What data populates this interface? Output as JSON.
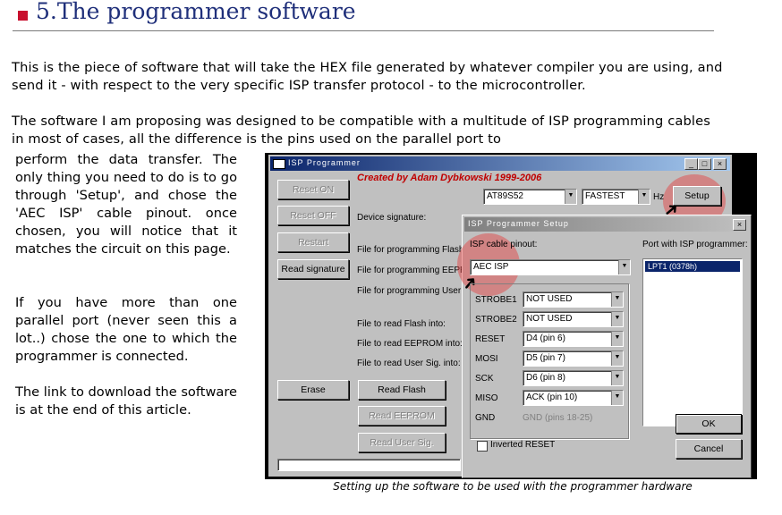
{
  "heading": "5.The programmer software",
  "paragraphs": [
    "This is the piece of software that will take the HEX file generated by whatever compiler you are using, and",
    "send it - with respect to the very specific ISP transfer protocol - to the microcontroller.",
    "The software I am proposing was designed to be compatible with a multitude of ISP programming cables",
    "in most of cases, all the difference is the pins used on the parallel port to"
  ],
  "side_text": {
    "p1": "perform the data transfer. The only thing you need to do is to go through 'Setup', and chose the 'AEC ISP' cable pinout. once chosen, you will notice that it matches the circuit on this page.",
    "p2": "If you have more than one parallel port (never seen this a lot..) chose the one to which the programmer is connected.",
    "p3": "The link to download the software is at the end of this article."
  },
  "caption": "Setting up the software to be used with the programmer hardware",
  "main_window": {
    "title": "ISP Programmer",
    "credit": "Created by Adam Dybkowski  1999-2006",
    "device": "AT89S52",
    "speed": "FASTEST",
    "hz": "Hz",
    "setup_button": "Setup",
    "buttons": {
      "reset_on": "Reset ON",
      "reset_off": "Reset OFF",
      "restart": "Restart",
      "read_signature": "Read signature",
      "erase": "Erase",
      "read_flash": "Read Flash",
      "read_eeprom": "Read EEPROM",
      "read_user_sig": "Read User Sig."
    },
    "labels": {
      "device_signature": "Device signature:",
      "file_prog_flash": "File for programming Flash",
      "file_prog_eeprom": "File for programming EEPR",
      "file_prog_user": "File for programming User",
      "file_read_flash": "File to read Flash into:",
      "file_read_eeprom": "File to read EEPROM into:",
      "file_read_user": "File to read User Sig. into:"
    }
  },
  "setup_dialog": {
    "title": "ISP Programmer Setup",
    "cable_label": "ISP cable pinout:",
    "cable_value": "AEC ISP",
    "port_label": "Port with ISP programmer:",
    "port_value": "LPT1  (0378h)",
    "pins": [
      {
        "name": "STROBE1",
        "value": "NOT USED"
      },
      {
        "name": "STROBE2",
        "value": "NOT USED"
      },
      {
        "name": "RESET",
        "value": "D4 (pin 6)"
      },
      {
        "name": "MOSI",
        "value": "D5 (pin 7)"
      },
      {
        "name": "SCK",
        "value": "D6 (pin 8)"
      },
      {
        "name": "MISO",
        "value": "ACK (pin 10)"
      }
    ],
    "gnd_label": "GND",
    "gnd_value": "GND (pins 18-25)",
    "inverted_reset": "Inverted RESET",
    "ok": "OK",
    "cancel": "Cancel"
  }
}
